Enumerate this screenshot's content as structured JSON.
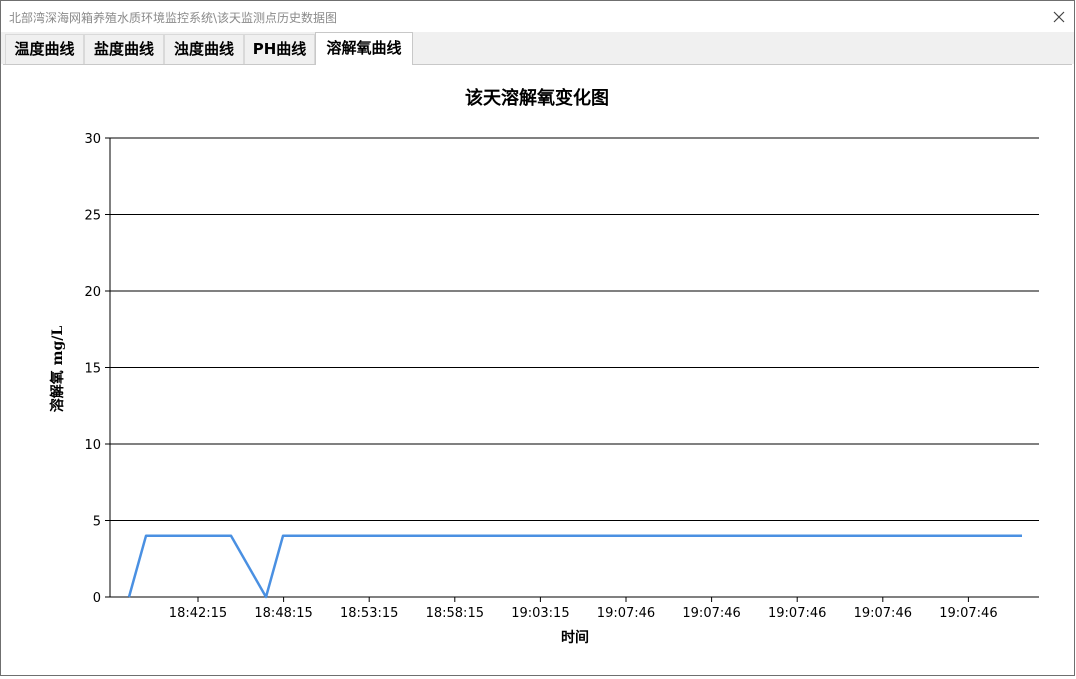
{
  "window": {
    "title": "北部湾深海网箱养殖水质环境监控系统\\该天监测点历史数据图"
  },
  "tabs": [
    {
      "label": "温度曲线",
      "active": false
    },
    {
      "label": "盐度曲线",
      "active": false
    },
    {
      "label": "浊度曲线",
      "active": false
    },
    {
      "label": "PH曲线",
      "active": false
    },
    {
      "label": "溶解氧曲线",
      "active": true
    }
  ],
  "chart_data": {
    "type": "line",
    "title": "该天溶解氧变化图",
    "xlabel": "时间",
    "ylabel": "溶解氧 mg/L",
    "ylim": [
      0,
      30
    ],
    "yticks": [
      0,
      5,
      10,
      15,
      20,
      25,
      30
    ],
    "xtick_labels": [
      "18:42:15",
      "18:48:15",
      "18:53:15",
      "18:58:15",
      "19:03:15",
      "19:07:46",
      "19:07:46",
      "19:07:46",
      "19:07:46",
      "19:07:46"
    ],
    "grid": "horizontal",
    "line_color": "#4a90e2",
    "series": [
      {
        "values": [
          0,
          4,
          4,
          4,
          4,
          0,
          4,
          4,
          4,
          4,
          4,
          4,
          4,
          4,
          4,
          4,
          4,
          4,
          4,
          4,
          4,
          4
        ]
      }
    ]
  }
}
